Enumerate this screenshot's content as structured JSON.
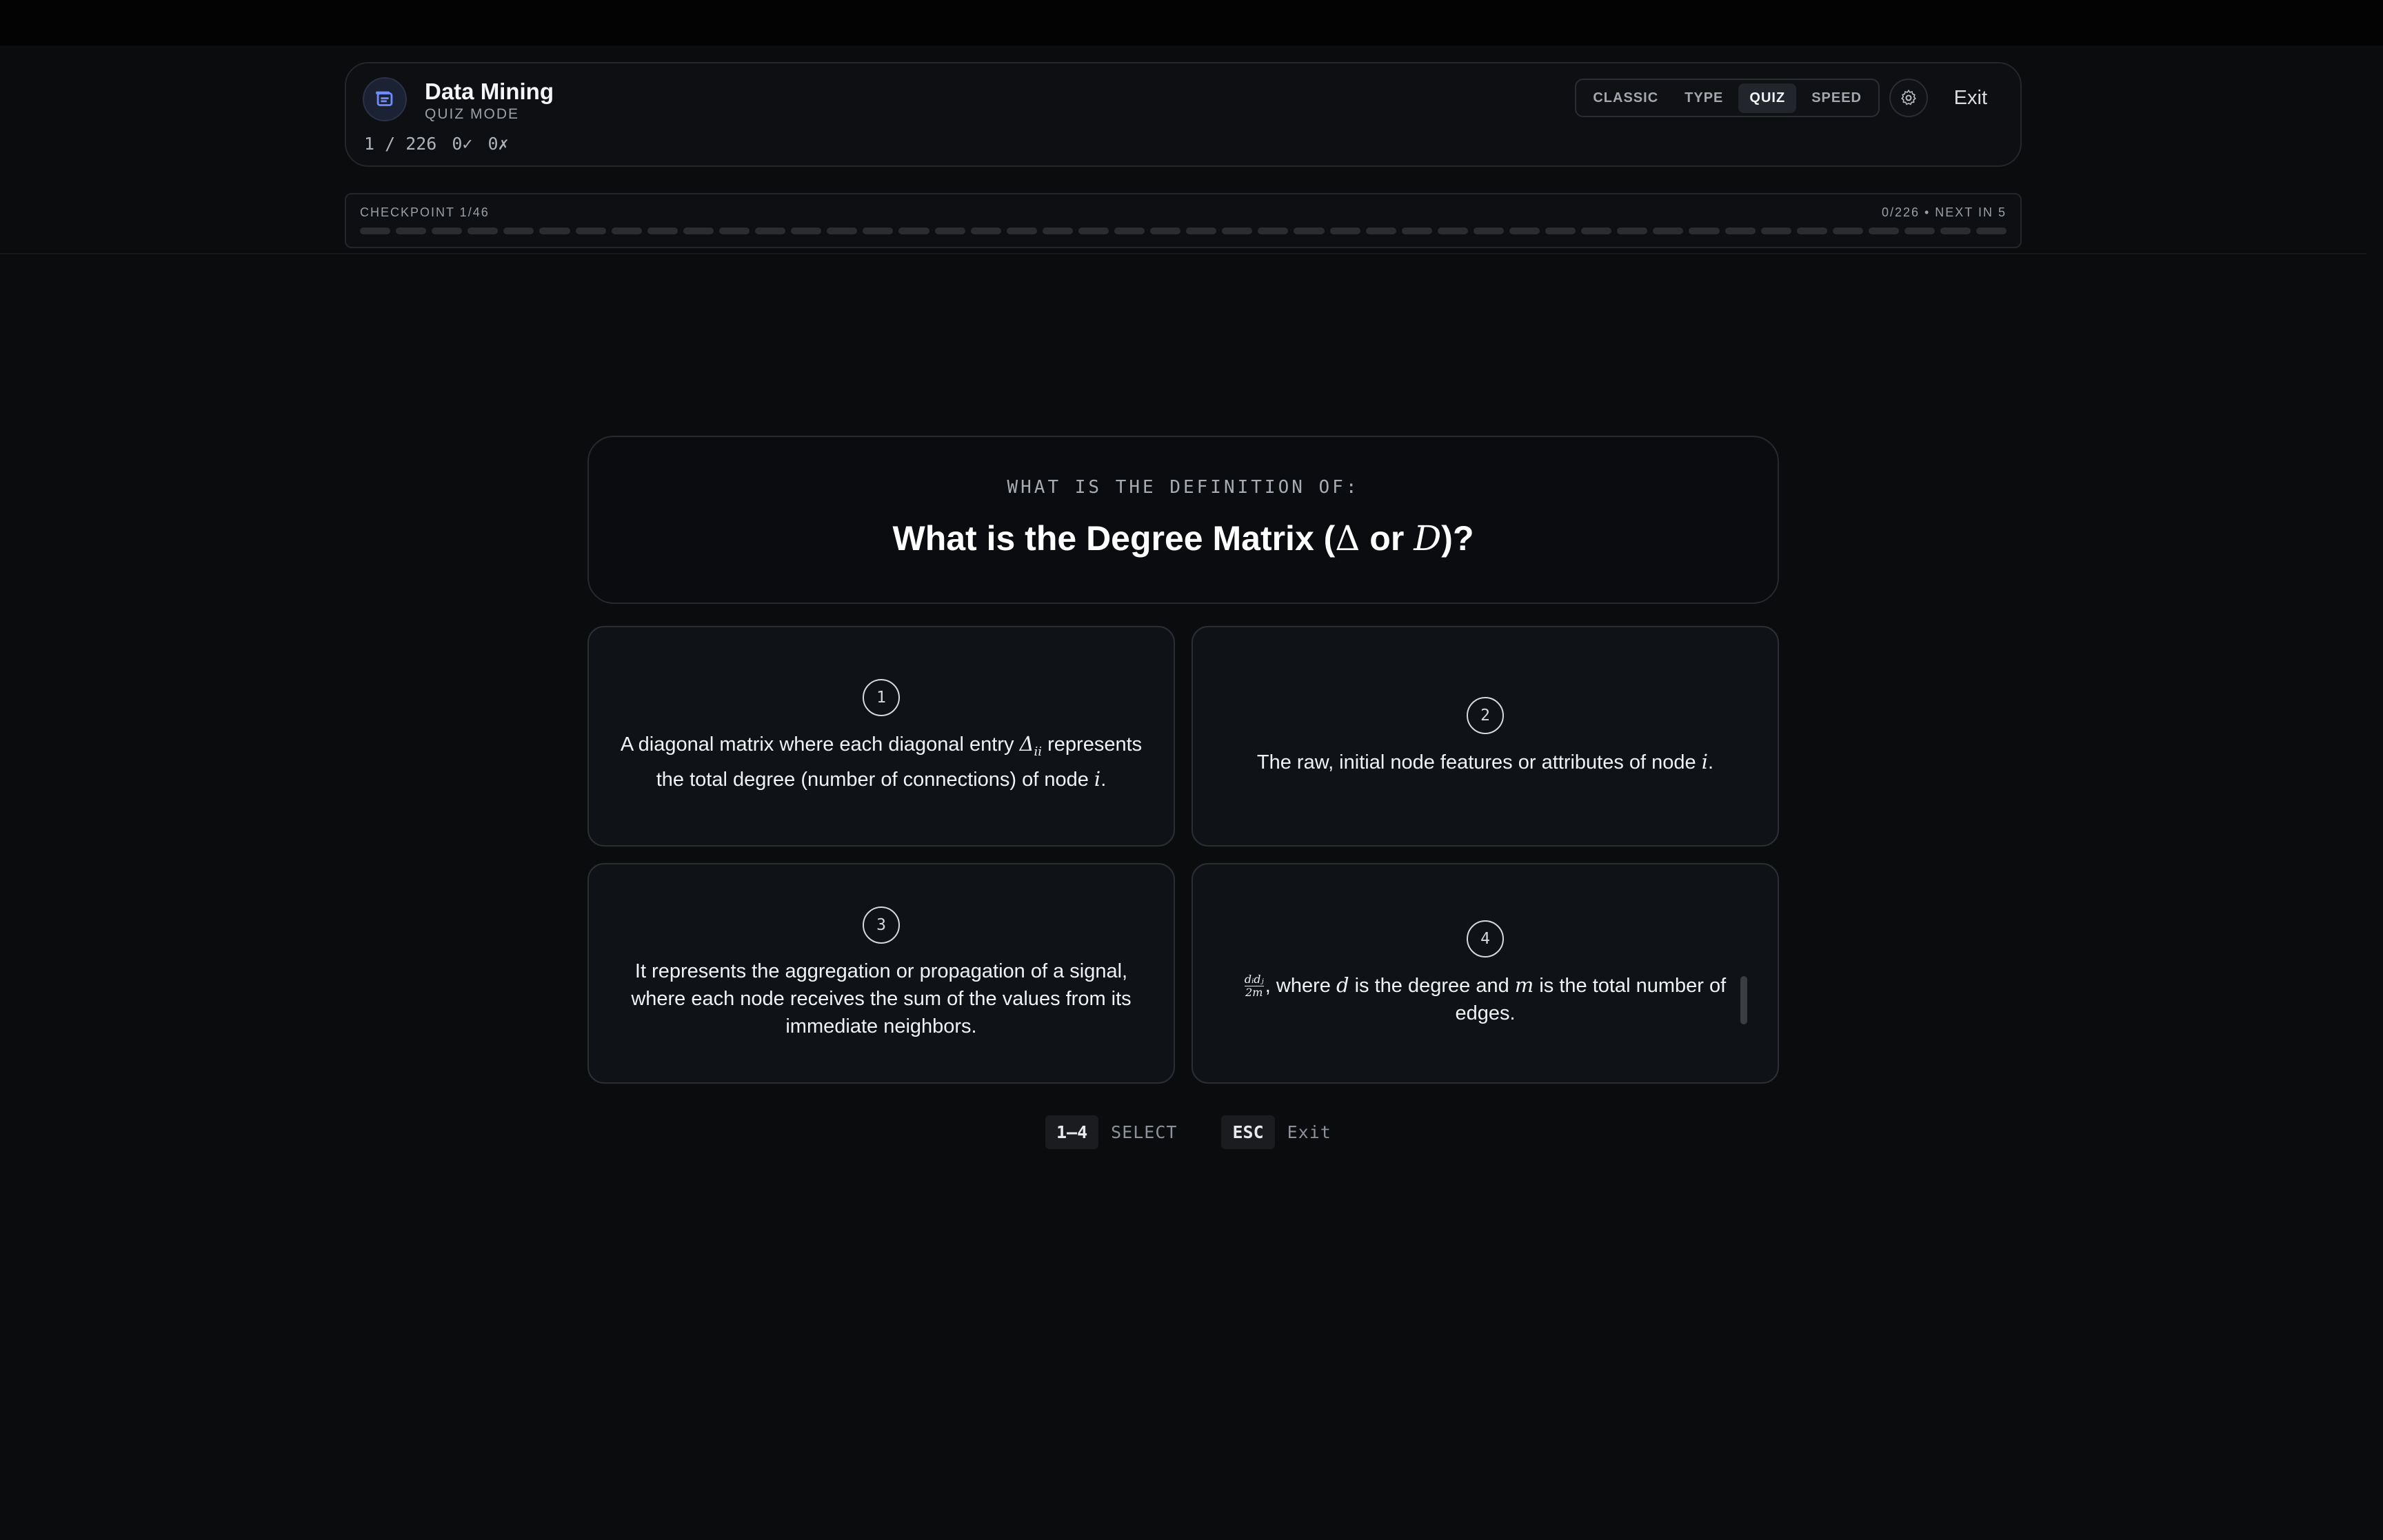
{
  "header": {
    "title": "Data Mining",
    "subtitle": "QUIZ MODE",
    "progress": "1 / 226",
    "correct": "0✓",
    "wrong": "0✗",
    "modes": [
      "CLASSIC",
      "TYPE",
      "QUIZ",
      "SPEED"
    ],
    "active_mode": "QUIZ",
    "exit_label": "Exit",
    "icons": {
      "app": "flashcard-icon",
      "settings": "gear-icon"
    }
  },
  "checkpoint": {
    "label": "CHECKPOINT 1/46",
    "right": "0/226 • NEXT IN 5",
    "segments_total": 46,
    "segments_done": 0
  },
  "question": {
    "prompt": "WHAT IS THE DEFINITION OF:",
    "text_prefix": "What is the Degree Matrix (",
    "symbol_delta": "Δ",
    "text_or": " or ",
    "symbol_d": "D",
    "text_suffix": ")?"
  },
  "options": [
    {
      "num": "1",
      "part1": "A diagonal matrix where each diagonal entry ",
      "math": "Δ",
      "sub": "ii",
      "part2": " represents the total degree (number of connections) of node ",
      "var": "i",
      "part3": "."
    },
    {
      "num": "2",
      "part1": "The raw, initial node features or attributes of node ",
      "var": "i",
      "part2": "."
    },
    {
      "num": "3",
      "text": "It represents the aggregation or propagation of a signal, where each node receives the sum of the values from its immediate neighbors."
    },
    {
      "num": "4",
      "frac_num": "dᵢdⱼ",
      "frac_den": "2m",
      "part1": ", where ",
      "var_d": "d",
      "part2": " is the degree and ",
      "var_m": "m",
      "part3": " is the total number of edges."
    }
  ],
  "hints": {
    "select_key": "1–4",
    "select_label": "SELECT",
    "exit_key": "ESC",
    "exit_label": "Exit"
  },
  "colors": {
    "background": "#0b0c0e",
    "card": "#0f1216",
    "border": "#2b2f35",
    "accent_icon": "#5b7cff"
  }
}
